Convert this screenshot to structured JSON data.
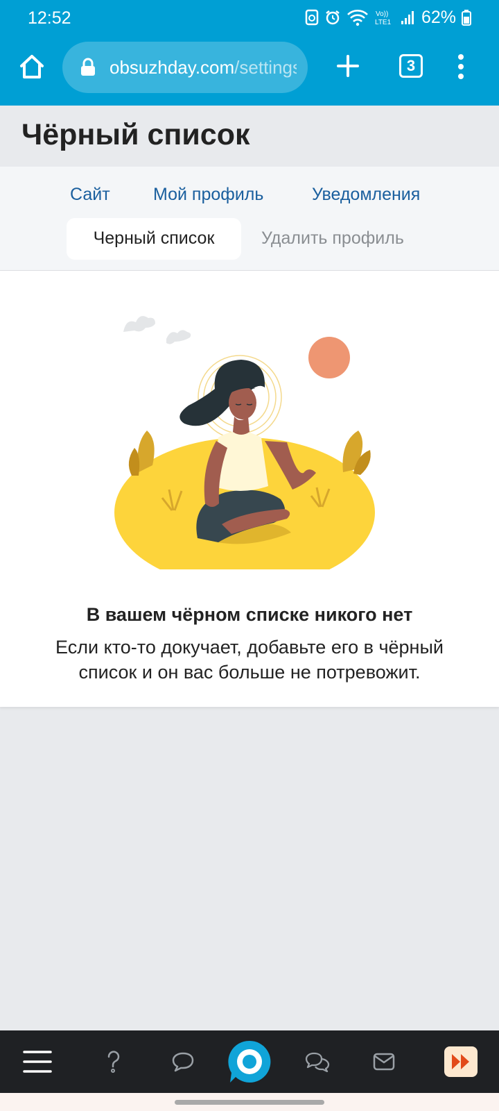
{
  "status_bar": {
    "time": "12:52",
    "battery": "62%",
    "network_label": "LTE1"
  },
  "browser": {
    "url_domain": "obsuzhday.com",
    "url_path": "/settings",
    "tab_count": "3",
    "accent_color": "#009fd4"
  },
  "page": {
    "title": "Чёрный список"
  },
  "settings_tabs": {
    "site": "Сайт",
    "my_profile": "Мой профиль",
    "notifications": "Уведомления",
    "blacklist": "Черный список",
    "delete_profile": "Удалить профиль"
  },
  "empty_state": {
    "title": "В вашем чёрном списке никого нет",
    "description": "Если кто-то докучает, добавьте его в чёрный список и он вас больше не потревожит."
  },
  "bottom_nav": {
    "items": [
      "menu-icon",
      "question-icon",
      "chat-icon",
      "home-logo-icon",
      "discussions-icon",
      "mail-icon",
      "fast-forward-icon"
    ]
  }
}
